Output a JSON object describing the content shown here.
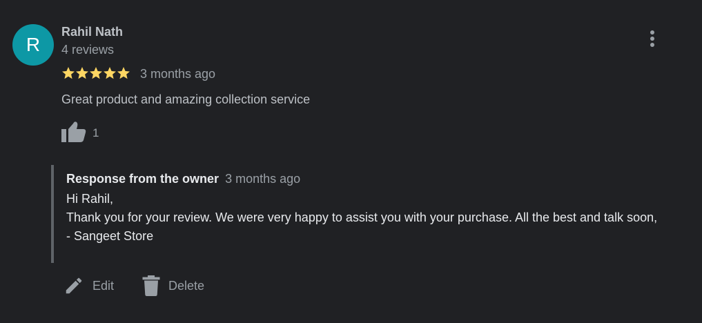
{
  "reviewer": {
    "initial": "R",
    "avatar_color": "#0d98a5",
    "name": "Rahil Nath",
    "review_count_text": "4 reviews"
  },
  "review": {
    "rating": 5,
    "rating_max": 5,
    "star_color": "#fdd663",
    "date": "3 months ago",
    "text": "Great product and amazing collection service",
    "likes": "1"
  },
  "owner_response": {
    "title": "Response from the owner",
    "date": "3 months ago",
    "lines": [
      "Hi Rahil,",
      "Thank you for your review. We were very happy to assist you with your purchase. All the best and talk soon,",
      "- Sangeet Store"
    ]
  },
  "actions": {
    "edit_label": "Edit",
    "delete_label": "Delete"
  },
  "icons": {
    "more": "more-vert-icon",
    "like": "thumb-up-icon",
    "edit": "pencil-icon",
    "delete": "trash-icon",
    "star": "star-icon"
  },
  "colors": {
    "background": "#202124",
    "primary_text": "#bdc1c6",
    "secondary_text": "#9aa0a6",
    "response_text": "#e8eaed",
    "response_border": "#5f6368"
  }
}
